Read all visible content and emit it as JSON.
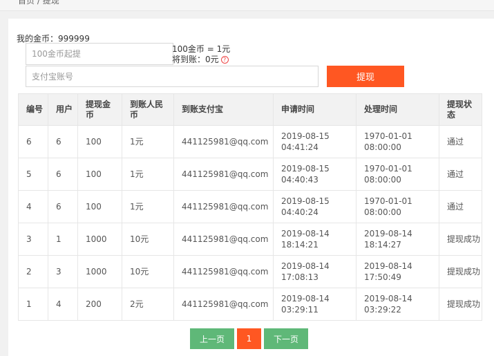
{
  "breadcrumb": {
    "home": "首页",
    "sep": "/",
    "current": "提现"
  },
  "wallet": {
    "label": "我的金币：",
    "value": "999999"
  },
  "form": {
    "amount_placeholder": "100金币起提",
    "account_placeholder": "支付宝账号",
    "rate_text": "100金币 = 1元",
    "receive_label": "将到账：0元",
    "submit_label": "提现"
  },
  "table": {
    "columns": [
      "编号",
      "用户",
      "提现金币",
      "到账人民币",
      "到账支付宝",
      "申请时间",
      "处理时间",
      "提现状态"
    ],
    "rows": [
      {
        "id": "6",
        "user": "6",
        "coins": "100",
        "rmb": "1元",
        "alipay": "441125981@qq.com",
        "apply_date": "2019-08-15",
        "apply_time": "04:41:24",
        "proc_date": "1970-01-01",
        "proc_time": "08:00:00",
        "status": "通过",
        "status_type": "pass"
      },
      {
        "id": "5",
        "user": "6",
        "coins": "100",
        "rmb": "1元",
        "alipay": "441125981@qq.com",
        "apply_date": "2019-08-15",
        "apply_time": "04:40:43",
        "proc_date": "1970-01-01",
        "proc_time": "08:00:00",
        "status": "通过",
        "status_type": "pass"
      },
      {
        "id": "4",
        "user": "6",
        "coins": "100",
        "rmb": "1元",
        "alipay": "441125981@qq.com",
        "apply_date": "2019-08-15",
        "apply_time": "04:40:24",
        "proc_date": "1970-01-01",
        "proc_time": "08:00:00",
        "status": "通过",
        "status_type": "pass"
      },
      {
        "id": "3",
        "user": "1",
        "coins": "1000",
        "rmb": "10元",
        "alipay": "441125981@qq.com",
        "apply_date": "2019-08-14",
        "apply_time": "18:14:21",
        "proc_date": "2019-08-14",
        "proc_time": "18:14:27",
        "status": "提现成功",
        "status_type": "ok"
      },
      {
        "id": "2",
        "user": "3",
        "coins": "1000",
        "rmb": "10元",
        "alipay": "441125981@qq.com",
        "apply_date": "2019-08-14",
        "apply_time": "17:08:13",
        "proc_date": "2019-08-14",
        "proc_time": "17:50:49",
        "status": "提现成功",
        "status_type": "ok"
      },
      {
        "id": "1",
        "user": "4",
        "coins": "200",
        "rmb": "2元",
        "alipay": "441125981@qq.com",
        "apply_date": "2019-08-14",
        "apply_time": "03:29:11",
        "proc_date": "2019-08-14",
        "proc_time": "03:29:22",
        "status": "提现成功",
        "status_type": "ok"
      }
    ]
  },
  "pagination": {
    "prev": "上一页",
    "current": "1",
    "next": "下一页"
  },
  "colors": {
    "accent": "#ff5722",
    "success": "#5fb878",
    "pass": "#e4393c"
  },
  "icons": {
    "help": "question-circle-icon"
  }
}
